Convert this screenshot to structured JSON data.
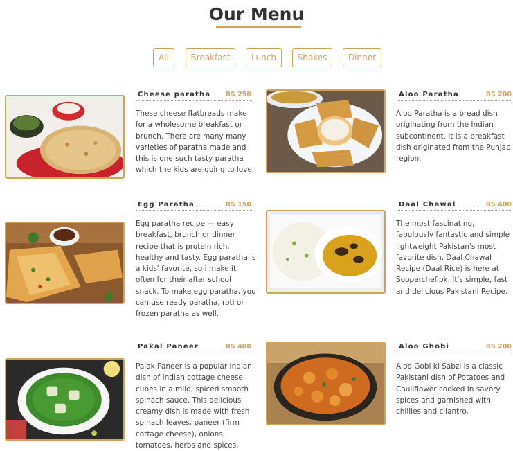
{
  "page": {
    "title": "Our Menu"
  },
  "filters": [
    "All",
    "Breakfast",
    "Lunch",
    "Shakes",
    "Dinner"
  ],
  "colors": {
    "accent": "#cda45e",
    "heading": "#333333",
    "text": "#444444"
  },
  "items": [
    {
      "name": "Cheese paratha",
      "price": "RS 250",
      "image": "cheese-paratha-photo",
      "desc": "These cheese flatbreads make for a wholesome breakfast or brunch. There are many many varieties of paratha made and this is one such tasty paratha which the kids are going to love."
    },
    {
      "name": "Aloo Paratha",
      "price": "RS 200",
      "image": "aloo-paratha-photo",
      "desc": "Aloo Paratha is a bread dish originating from the Indian subcontinent. It is a breakfast dish originated from the Punjab region."
    },
    {
      "name": "Egg Paratha",
      "price": "RS 150",
      "image": "egg-paratha-photo",
      "desc": "Egg paratha recipe — easy breakfast, brunch or dinner recipe that is protein rich, healthy and tasty. Egg paratha is a kids' favorite, so i make it often for their after school snack. To make egg paratha, you can use ready paratha, roti or frozen paratha as well."
    },
    {
      "name": "Daal Chawal",
      "price": "RS 400",
      "image": "daal-chawal-photo",
      "desc": "The most fascinating, fabulously fantastic and simple lightweight Pakistan's most favorite dish, Daal Chawal Recipe (Daal Rice) is here at Sooperchef.pk. It's simple, fast and delicious Pakistani Recipe."
    },
    {
      "name": "Pakal Paneer",
      "price": "RS 400",
      "image": "palak-paneer-photo",
      "desc": "Palak Paneer is a popular Indian dish of Indian cottage cheese cubes in a mild, spiced smooth spinach sauce. This delicious creamy dish is made with fresh spinach leaves, paneer (firm cottage cheese), onions, tomatoes, herbs and spices."
    },
    {
      "name": "Aloo Ghobi",
      "price": "RS 200",
      "image": "aloo-gobi-photo",
      "desc": "Aloo Gobi ki Sabzi is a classic Pakistani dish of Potatoes and Cauliflower cooked in savory spices and garnished with chillies and cilantro."
    }
  ]
}
